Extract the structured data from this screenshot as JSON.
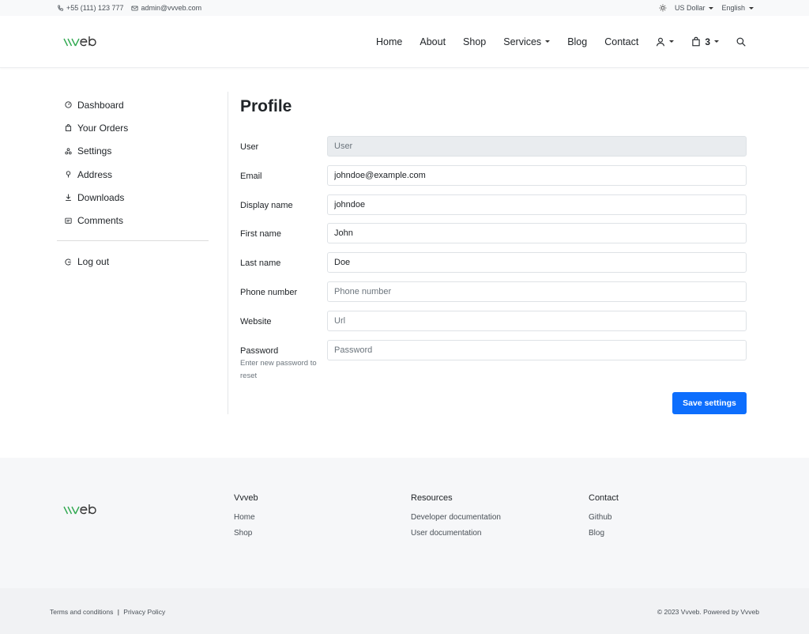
{
  "topbar": {
    "phone": "+55 (111) 123 777",
    "email": "admin@vvveb.com",
    "currency": "US Dollar",
    "language": "English"
  },
  "header": {
    "logo_prefix": "\\\\\\",
    "logo_suffix": "eb",
    "nav": {
      "home": "Home",
      "about": "About",
      "shop": "Shop",
      "services": "Services",
      "blog": "Blog",
      "contact": "Contact"
    },
    "cart_count": "3"
  },
  "sidebar": {
    "items": [
      {
        "label": "Dashboard",
        "icon": "gauge-icon"
      },
      {
        "label": "Your Orders",
        "icon": "bag-icon"
      },
      {
        "label": "Settings",
        "icon": "settings-icon"
      },
      {
        "label": "Address",
        "icon": "pin-icon"
      },
      {
        "label": "Downloads",
        "icon": "download-icon"
      },
      {
        "label": "Comments",
        "icon": "comment-icon"
      }
    ],
    "logout": "Log out"
  },
  "profile": {
    "title": "Profile",
    "fields": {
      "user": {
        "label": "User",
        "value": "User"
      },
      "email": {
        "label": "Email",
        "value": "johndoe@example.com"
      },
      "display_name": {
        "label": "Display name",
        "value": "johndoe"
      },
      "first_name": {
        "label": "First name",
        "value": "John"
      },
      "last_name": {
        "label": "Last name",
        "value": "Doe"
      },
      "phone": {
        "label": "Phone number",
        "placeholder": "Phone number"
      },
      "website": {
        "label": "Website",
        "placeholder": "Url"
      },
      "password": {
        "label": "Password",
        "hint": "Enter new password to reset",
        "placeholder": "Password"
      }
    },
    "save_label": "Save settings"
  },
  "footer": {
    "col1": {
      "title": "Vvveb",
      "links": [
        "Home",
        "Shop"
      ]
    },
    "col2": {
      "title": "Resources",
      "links": [
        "Developer documentation",
        "User documentation"
      ]
    },
    "col3": {
      "title": "Contact",
      "links": [
        "Github",
        "Blog"
      ]
    },
    "terms": "Terms and conditions",
    "separator": "|",
    "privacy": "Privacy Policy",
    "copyright": "© 2023 Vvveb. Powered by Vvveb"
  },
  "colors": {
    "accent": "#0d6efd",
    "logo_green": "#2fa84f"
  }
}
